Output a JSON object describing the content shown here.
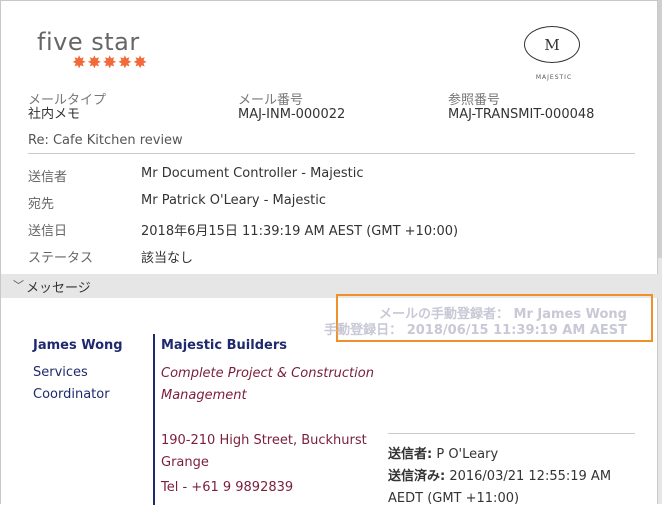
{
  "brand": {
    "five_star_text": "five star",
    "stars": "✸✸✸✸✸",
    "majestic_mark": "M",
    "majestic_text": "MAJESTIC"
  },
  "meta": {
    "mail_type_label": "メールタイプ",
    "mail_type_value": "社内メモ",
    "mail_number_label": "メール番号",
    "mail_number_value": "MAJ-INM-000022",
    "reference_label": "参照番号",
    "reference_value": "MAJ-TRANSMIT-000048"
  },
  "subject": "Re: Cafe Kitchen review",
  "fields": [
    {
      "label": "送信者",
      "value": "Mr Document Controller - Majestic"
    },
    {
      "label": "宛先",
      "value": "Mr Patrick O'Leary - Majestic"
    },
    {
      "label": "送信日",
      "value": "2018年6月15日 11:39:19 AM AEST (GMT +10:00)"
    },
    {
      "label": "ステータス",
      "value": "該当なし"
    }
  ],
  "message_section": {
    "toggle_icon": "chevron-down-icon",
    "label": "メッセージ"
  },
  "manual_registration": {
    "registrant_label": "メールの手動登録者：",
    "registrant_value": "Mr James Wong",
    "date_label": "手動登録日：",
    "date_value": "2018/06/15 11:39:19 AM AEST"
  },
  "signature": {
    "name": "James Wong",
    "title_line1": "Services",
    "title_line2": "Coordinator",
    "company": "Majestic Builders",
    "tagline": "Complete Project & Construction Management",
    "address": "190-210 High Street, Buckhurst Grange",
    "tel": "Tel - +61 9 9892839"
  },
  "forwarded": {
    "sender_label": "送信者:",
    "sender_value": "P O'Leary",
    "sent_label": "送信済み:",
    "sent_value": "2016/03/21 12:55:19 AM AEDT (GMT +11:00)"
  },
  "colors": {
    "star": "#f26a3b",
    "highlight_border": "#f0902a",
    "signature_blue": "#1f2a6e",
    "signature_maroon": "#7a1f3a",
    "section_bar": "#e6e6e6"
  }
}
